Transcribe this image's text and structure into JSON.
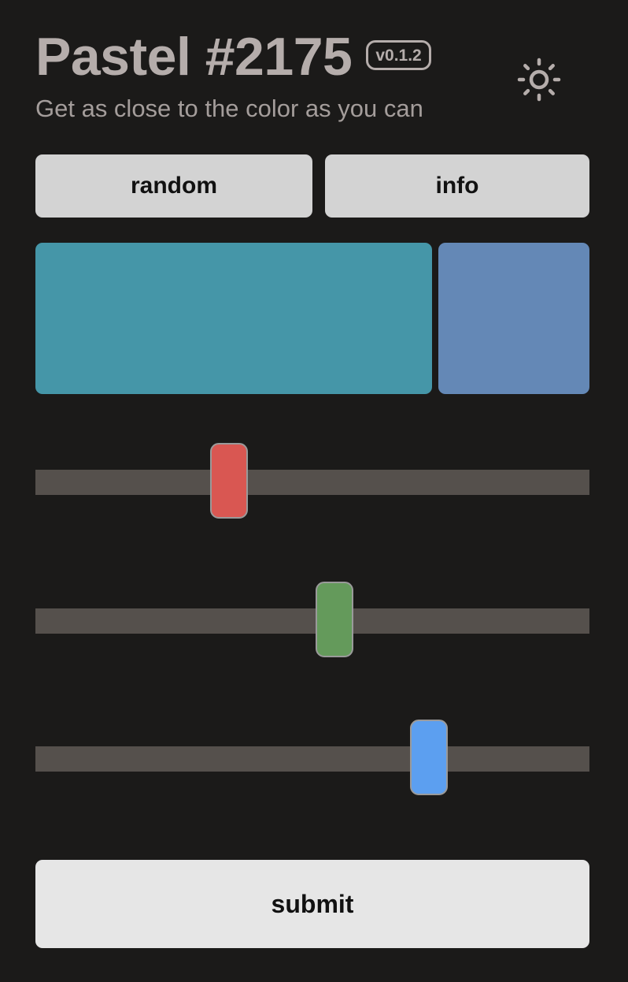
{
  "header": {
    "title": "Pastel #2175",
    "version": "v0.1.2",
    "subtitle": "Get as close to the color as you can",
    "theme_icon": "sun-icon"
  },
  "actions": {
    "random_label": "random",
    "info_label": "info",
    "submit_label": "submit"
  },
  "swatches": {
    "target_color": "#4596a8",
    "guess_color": "#6488b6"
  },
  "sliders": [
    {
      "channel": "red",
      "thumb_color": "#d95752",
      "position": 0.35
    },
    {
      "channel": "green",
      "thumb_color": "#649a5b",
      "position": 0.54
    },
    {
      "channel": "blue",
      "thumb_color": "#5c9ff0",
      "position": 0.71
    }
  ],
  "colors": {
    "background": "#1b1a19",
    "text": "#b5adab",
    "track": "#55504c",
    "button": "#d3d3d3",
    "submit": "#e6e6e6"
  }
}
